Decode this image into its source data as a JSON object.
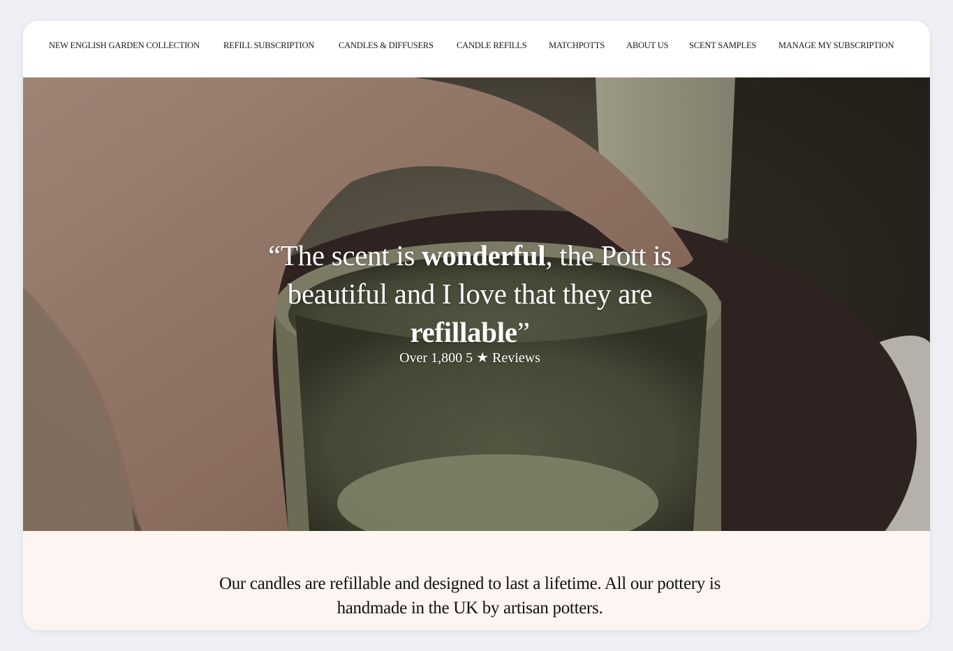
{
  "nav": {
    "items": [
      {
        "label": "NEW ENGLISH GARDEN COLLECTION"
      },
      {
        "label": "REFILL SUBSCRIPTION"
      },
      {
        "label": "CANDLES & DIFFUSERS"
      },
      {
        "label": "CANDLE REFILLS"
      },
      {
        "label": "MATCHPOTTS"
      },
      {
        "label": "ABOUT US"
      },
      {
        "label": "SCENT SAMPLES"
      },
      {
        "label": "MANAGE MY SUBSCRIPTION"
      }
    ]
  },
  "hero": {
    "quote_open": "“The scent is ",
    "quote_bold1": "wonderful",
    "quote_mid": ", the Pott is beautiful and I love that they are ",
    "quote_bold2": "refillable",
    "quote_close": "”",
    "reviews": "Over 1,800 5 ★ Reviews"
  },
  "intro": {
    "text": "Our candles are refillable and designed to last a lifetime. All our pottery is handmade in the UK by artisan potters."
  },
  "colors": {
    "page_bg": "#eef0f5",
    "intro_bg": "#fdf5f1",
    "text_dark": "#111111",
    "hero_text": "#ffffff"
  }
}
